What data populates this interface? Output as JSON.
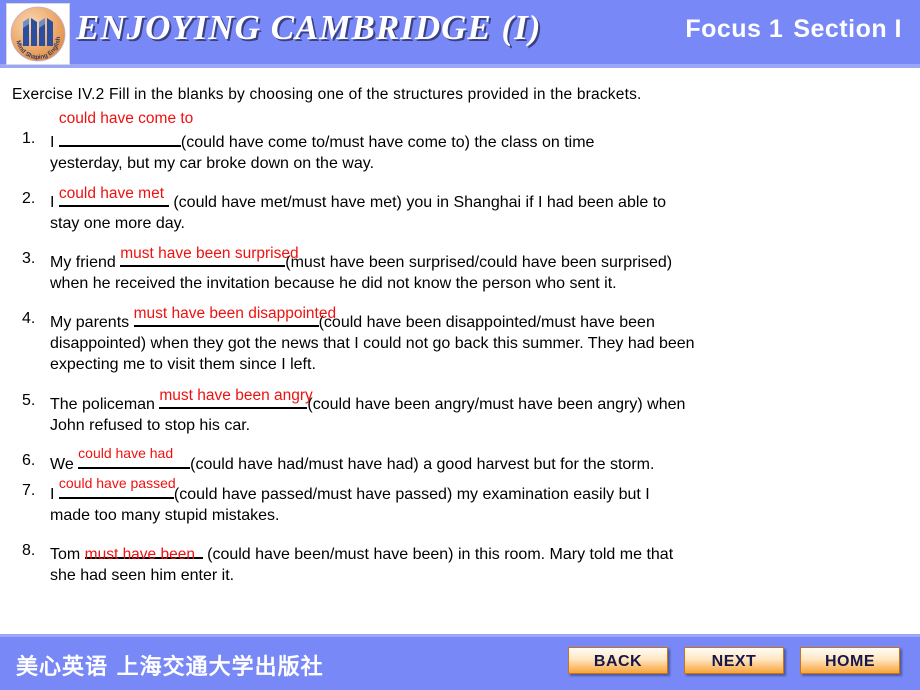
{
  "header": {
    "logo": {
      "name": "mind-shaping-english-logo",
      "circle_color": "#e8a86a",
      "mark_color": "#2b4f9e",
      "curved_text": "Mind Shaping English"
    },
    "course_title": "ENJOYING  CAMBRIDGE (I)",
    "focus_label": "Focus 1",
    "section_label": "Section I",
    "background_color": "#7888f7"
  },
  "content": {
    "instruction": "Exercise  IV.2   Fill in the blanks  by choosing  one of the structures  provided  in the brackets.",
    "answer_color": "#ee1111",
    "questions": [
      {
        "number": "1.",
        "before": "I ",
        "answer": "could have come to",
        "answer_style": "above",
        "blank_width": 122,
        "after": "(could have come to/must have come to) the class on time",
        "continuation": "yesterday,  but my car broke down on the way."
      },
      {
        "number": "2.",
        "before": "I ",
        "answer": "could have met",
        "answer_style": "on",
        "blank_width": 110,
        "after": " (could have met/must have met) you in Shanghai  if I had been able to",
        "continuation": "stay one more day."
      },
      {
        "number": "3.",
        "before": "My friend ",
        "answer": "must have been surprised",
        "answer_style": "on",
        "blank_width": 165,
        "after": "(must  have been surprised/could  have been surprised)",
        "continuation": "when he received  the invitation  because he did not know the person who sent it."
      },
      {
        "number": "4.",
        "before": "My parents ",
        "answer": "must have been disappointed",
        "answer_style": "on",
        "blank_width": 185,
        "after": "(could have been disappointed/must  have been",
        "continuation": "disappointed)  when they got the news that I could  not go back this summer.  They had been",
        "continuation2": "expecting  me to visit them since  I left."
      },
      {
        "number": "5.",
        "before": "The policeman  ",
        "answer": "must have been angry",
        "answer_style": "on",
        "blank_width": 148,
        "after": "(could have been angry/must  have been angry) when",
        "continuation": "John refused to stop his car."
      },
      {
        "number": "6.",
        "before": "We ",
        "answer": "could have had",
        "answer_style": "mid",
        "blank_width": 112,
        "after": "(could have had/must have had) a good harvest  but for the storm.",
        "continuation": ""
      },
      {
        "number": "7.",
        "before": "I ",
        "answer": "could have passed",
        "answer_style": "mid",
        "blank_width": 115,
        "after": "(could  have passed/must have passed) my examination  easily but I",
        "continuation": "made too many stupid  mistakes."
      },
      {
        "number": "8.",
        "before": "Tom ",
        "answer": "must have been",
        "answer_style": "below",
        "blank_width": 118,
        "after": " (could have been/must  have been) in this room. Mary told me that",
        "continuation": "she had seen him enter it."
      }
    ]
  },
  "footer": {
    "publisher": "美心英语  上海交通大学出版社",
    "buttons": [
      {
        "label": "BACK",
        "name": "back-button"
      },
      {
        "label": "NEXT",
        "name": "next-button"
      },
      {
        "label": "HOME",
        "name": "home-button"
      }
    ],
    "background_color": "#7888f7",
    "button_accent": "#f8a43a"
  }
}
